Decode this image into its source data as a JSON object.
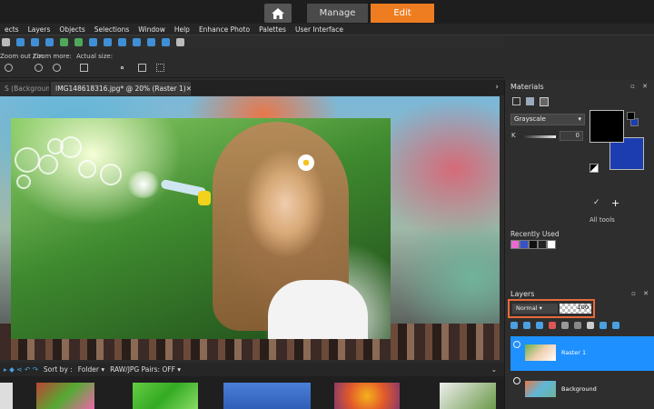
{
  "top_tabs": {
    "manage": "Manage",
    "edit": "Edit"
  },
  "menu": [
    "ects",
    "Layers",
    "Objects",
    "Selections",
    "Window",
    "Help",
    "Enhance Photo",
    "Palettes",
    "User Interface"
  ],
  "options": {
    "zoom_out_in": "Zoom out / in:",
    "zoom_more": "Zoom more:",
    "actual_size": "Actual size:"
  },
  "doc_tabs": {
    "inactive": "S (Background)",
    "active": "IMG148618316.jpg* @  20% (Raster 1)",
    "close": "✕",
    "more": "›"
  },
  "filmstrip": {
    "sort_by": "Sort by :",
    "sort_value": "Folder ▾",
    "raw_pairs": "RAW/JPG Pairs: OFF ▾"
  },
  "materials": {
    "title": "Materials",
    "select": "Grayscale",
    "k_label": "K",
    "k_value": "0",
    "all_tools": "All tools",
    "recently_used": "Recently Used",
    "recent_colors": [
      "#e86ad0",
      "#3552c8",
      "#111111",
      "#222222",
      "#ffffff"
    ],
    "fg_color": "#000000",
    "bg_color": "#1b3db0"
  },
  "layers": {
    "title": "Layers",
    "blend_mode": "Normal",
    "opacity": "100",
    "items": [
      {
        "name": "Raster 1",
        "selected": true
      },
      {
        "name": "Background",
        "selected": false
      }
    ]
  },
  "panel_controls": "▫ ✕"
}
